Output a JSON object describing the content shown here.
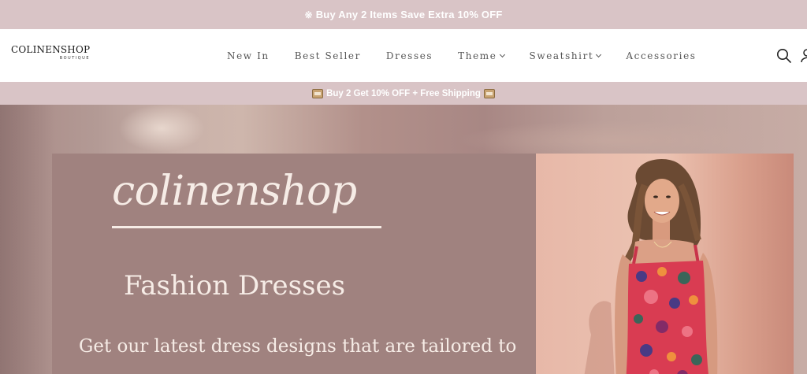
{
  "announcement": {
    "icon": "sparkle-icon",
    "text": "Buy Any 2 Items Save Extra 10% OFF"
  },
  "header": {
    "logo": {
      "name": "COLINENSHOP",
      "tagline": "BOUTIQUE"
    },
    "nav": [
      {
        "label": "New In",
        "has_dropdown": false
      },
      {
        "label": "Best Seller",
        "has_dropdown": false
      },
      {
        "label": "Dresses",
        "has_dropdown": false
      },
      {
        "label": "Theme",
        "has_dropdown": true
      },
      {
        "label": "Sweatshirt",
        "has_dropdown": true
      },
      {
        "label": "Accessories",
        "has_dropdown": false
      }
    ],
    "icons": [
      "search-icon",
      "user-icon"
    ]
  },
  "promo_bar": {
    "text": "Buy 2 Get 10% OFF + Free Shipping",
    "icon": "package-icon"
  },
  "hero": {
    "brand": "colinenshop",
    "title": "Fashion Dresses",
    "description": "Get our latest dress designs that are tailored to"
  },
  "colors": {
    "bar_bg": "#d9c4c6",
    "panel_bg": "#a0827f",
    "hero_text": "#f6ece6"
  }
}
